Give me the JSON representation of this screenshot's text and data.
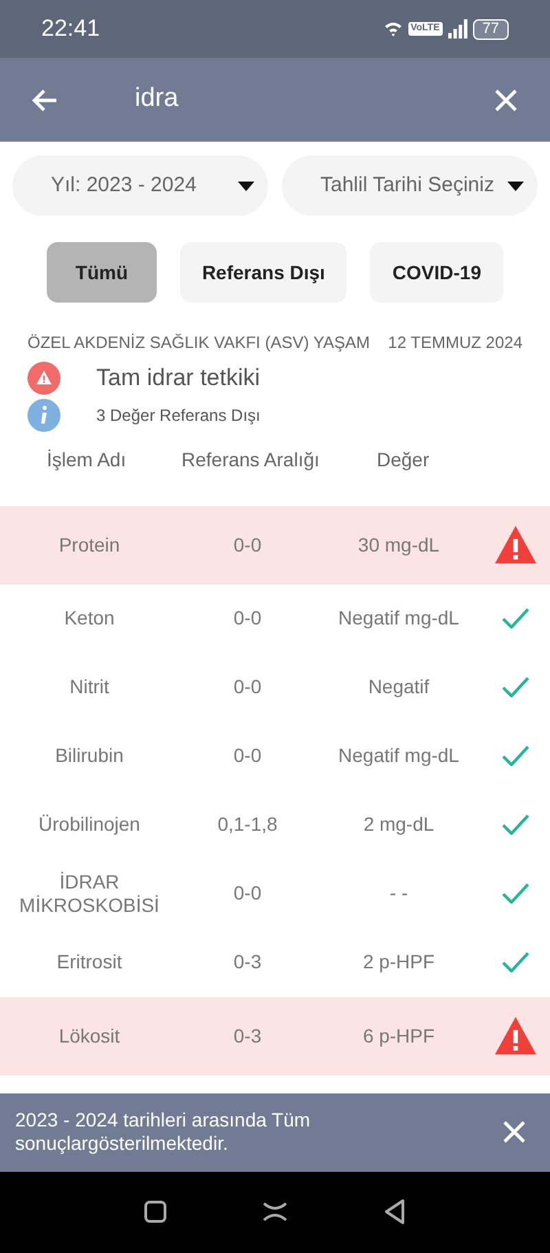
{
  "status_bar": {
    "time": "22:41",
    "network_badge": "VoLTE",
    "battery": "77"
  },
  "app_bar": {
    "search_value": "idra"
  },
  "filters": [
    {
      "label": "Yıl: 2023 - 2024"
    },
    {
      "label": "Tahlil Tarihi Seçiniz"
    }
  ],
  "tabs": [
    {
      "label": "Tümü",
      "selected": true
    },
    {
      "label": "Referans Dışı",
      "selected": false
    },
    {
      "label": "COVID-19",
      "selected": false
    }
  ],
  "report": {
    "hospital": "ÖZEL AKDENİZ SAĞLIK VAKFI (ASV) YAŞAM",
    "date": "12 TEMMUZ 2024",
    "test_name": "Tam idrar tetkiki",
    "summary": "3 Değer Referans Dışı"
  },
  "table": {
    "columns": [
      "İşlem Adı",
      "Referans Aralığı",
      "Değer"
    ],
    "rows": [
      {
        "name": "Protein",
        "range": "0-0",
        "value": "30 mg-dL",
        "out_of_range": true
      },
      {
        "name": "Keton",
        "range": "0-0",
        "value": "Negatif mg-dL",
        "out_of_range": false
      },
      {
        "name": "Nitrit",
        "range": "0-0",
        "value": "Negatif",
        "out_of_range": false
      },
      {
        "name": "Bilirubin",
        "range": "0-0",
        "value": "Negatif mg-dL",
        "out_of_range": false
      },
      {
        "name": "Ürobilinojen",
        "range": "0,1-1,8",
        "value": "2 mg-dL",
        "out_of_range": false
      },
      {
        "name": "İDRAR MİKROSKOBİSİ",
        "range": "0-0",
        "value": "- -",
        "out_of_range": false
      },
      {
        "name": "Eritrosit",
        "range": "0-3",
        "value": "2 p-HPF",
        "out_of_range": false
      },
      {
        "name": "Lökosit",
        "range": "0-3",
        "value": "6 p-HPF",
        "out_of_range": true
      }
    ]
  },
  "snackbar": {
    "message": "2023 - 2024 tarihleri arasında Tüm sonuçlargösterilmektedir."
  }
}
